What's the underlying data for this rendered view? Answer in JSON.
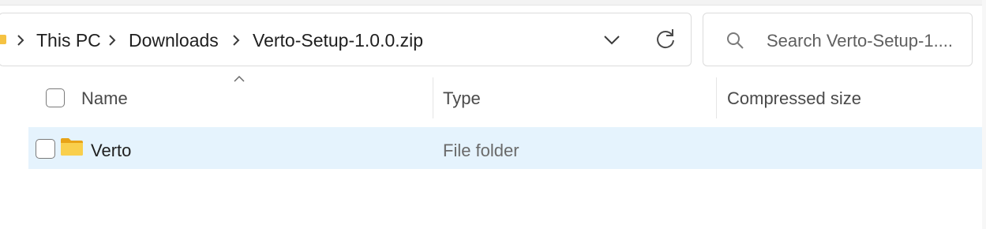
{
  "address_bar": {
    "breadcrumbs": [
      "This PC",
      "Downloads",
      "Verto-Setup-1.0.0.zip"
    ]
  },
  "search": {
    "placeholder": "Search Verto-Setup-1...."
  },
  "columns": {
    "name": "Name",
    "type": "Type",
    "compressed_size": "Compressed size"
  },
  "rows": [
    {
      "name": "Verto",
      "type": "File folder",
      "compressed_size": "",
      "icon": "folder-icon"
    }
  ],
  "colors": {
    "selection_bg": "#e5f3fd",
    "folder": "#f5c242"
  }
}
